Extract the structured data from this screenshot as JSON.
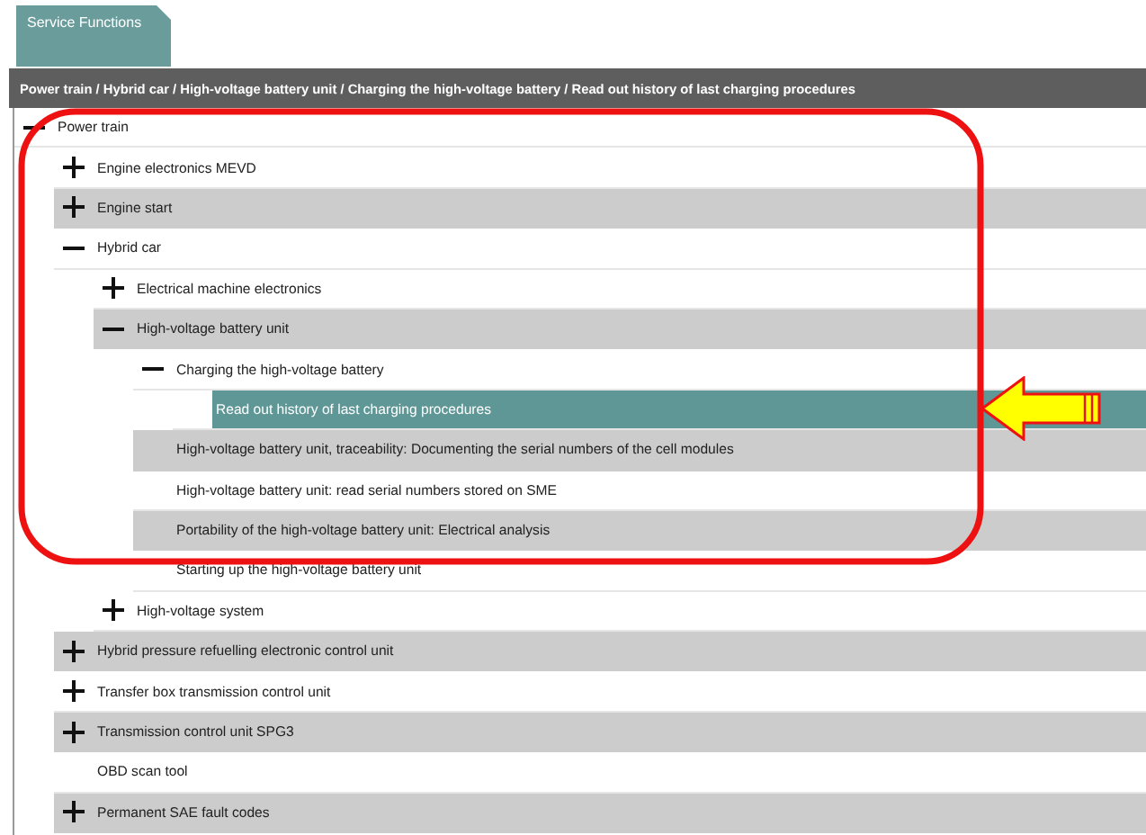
{
  "tab": {
    "label": "Service Functions",
    "selected": true
  },
  "breadcrumb": "Power train / Hybrid car / High-voltage battery unit / Charging the high-voltage battery / Read out history of last charging procedures",
  "tree": [
    {
      "label": "Power train",
      "kind": "group",
      "expanded": true,
      "selected": false,
      "children": [
        {
          "label": "Engine electronics MEVD",
          "kind": "group",
          "expanded": false,
          "selected": false
        },
        {
          "label": "Engine start",
          "kind": "group",
          "expanded": false,
          "selected": false
        },
        {
          "label": "Hybrid car",
          "kind": "group",
          "expanded": true,
          "selected": false,
          "children": [
            {
              "label": "Electrical machine electronics",
              "kind": "group",
              "expanded": false,
              "selected": false
            },
            {
              "label": "High-voltage battery unit",
              "kind": "group",
              "expanded": true,
              "selected": false,
              "children": [
                {
                  "label": "Charging the high-voltage battery",
                  "kind": "group",
                  "expanded": true,
                  "selected": false,
                  "children": [
                    {
                      "label": "Read out history of last charging procedures",
                      "kind": "leaf",
                      "selected": true
                    }
                  ]
                },
                {
                  "label": "High-voltage battery unit, traceability: Documenting the serial numbers of the cell modules",
                  "kind": "leaf",
                  "selected": false
                },
                {
                  "label": "High-voltage battery unit: read serial numbers stored on SME",
                  "kind": "leaf",
                  "selected": false
                },
                {
                  "label": "Portability of the high-voltage battery unit: Electrical analysis",
                  "kind": "leaf",
                  "selected": false
                },
                {
                  "label": "Starting up the high-voltage battery unit",
                  "kind": "leaf",
                  "selected": false
                }
              ]
            },
            {
              "label": "High-voltage system",
              "kind": "group",
              "expanded": false,
              "selected": false
            }
          ]
        },
        {
          "label": "Hybrid pressure refuelling electronic control unit",
          "kind": "group",
          "expanded": false,
          "selected": false
        },
        {
          "label": "Transfer box transmission control unit",
          "kind": "group",
          "expanded": false,
          "selected": false
        },
        {
          "label": "Transmission control unit SPG3",
          "kind": "group",
          "expanded": false,
          "selected": false
        },
        {
          "label": "OBD scan tool",
          "kind": "leaf",
          "selected": false
        },
        {
          "label": "Permanent SAE fault codes",
          "kind": "group",
          "expanded": false,
          "selected": false
        }
      ]
    }
  ]
}
